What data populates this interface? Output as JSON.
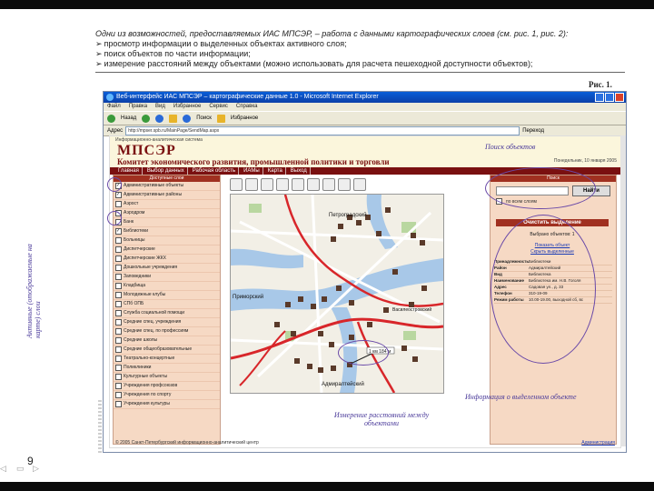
{
  "slide": {
    "intro": "Одни из возможностей, предоставляемых ИАС МПСЭР, – работа с данными картографических слоев (см. рис. 1, рис. 2):",
    "bullets": [
      "просмотр информации о выделенных объектах активного слоя;",
      "поиск объектов по части информации;",
      "измерение расстояний между объектами (можно использовать для расчета пешеходной доступности объектов);"
    ],
    "figure_label": "Рис. 1.",
    "page_number": "9"
  },
  "browser": {
    "title": "Веб-интерфейс ИАС МПСЭР – картографические данные 1.0 - Microsoft Internet Explorer",
    "menu": [
      "Файл",
      "Правка",
      "Вид",
      "Избранное",
      "Сервис",
      "Справка"
    ],
    "toolbar": {
      "back": "Назад",
      "search": "Поиск",
      "favorites": "Избранное"
    },
    "address_label": "Адрес",
    "address_value": "http://mpser.spb.ru/MainPage/SendMap.aspx",
    "go": "Переход"
  },
  "site": {
    "small_header": "Информационно-аналитическая система",
    "logo": "МПСЭР",
    "subtitle": "Комитет экономического развития, промышленной политики и торговли",
    "date": "Понедельник, 10 января 2005",
    "nav": [
      "Главная",
      "Выбор данных",
      "Рабочая область",
      "ИАМы",
      "Карта",
      "Выход"
    ],
    "layers_header": "Доступные слои",
    "layers": [
      {
        "label": "Административные объекты",
        "checked": true
      },
      {
        "label": "Административные районы",
        "checked": true
      },
      {
        "label": "Аэрост",
        "checked": false
      },
      {
        "label": "Аэродром",
        "checked": false
      },
      {
        "label": "Банк",
        "checked": false
      },
      {
        "label": "Библиотеки",
        "checked": true
      },
      {
        "label": "Больницы",
        "checked": false
      },
      {
        "label": "Диспетчерские",
        "checked": false
      },
      {
        "label": "Диспетчерские ЖКХ",
        "checked": false
      },
      {
        "label": "Дошкольные учреждения",
        "checked": false
      },
      {
        "label": "Заповедники",
        "checked": false
      },
      {
        "label": "Кладбища",
        "checked": false
      },
      {
        "label": "Молодежные клубы",
        "checked": false
      },
      {
        "label": "СПб ОПБ",
        "checked": false
      },
      {
        "label": "Служба социальной помощи",
        "checked": false
      },
      {
        "label": "Средние спец. учреждения",
        "checked": false
      },
      {
        "label": "Средние спец. по профессиям",
        "checked": false
      },
      {
        "label": "Средние школы",
        "checked": false
      },
      {
        "label": "Средние общеобразовательные",
        "checked": false
      },
      {
        "label": "Театрально-концертные",
        "checked": false
      },
      {
        "label": "Поликлиники",
        "checked": false
      },
      {
        "label": "Культурные объекты",
        "checked": false
      },
      {
        "label": "Учреждения профсоюзов",
        "checked": false
      },
      {
        "label": "Учреждения по спорту",
        "checked": false
      },
      {
        "label": "Учреждения культуры",
        "checked": false
      }
    ],
    "search_header": "Поиск",
    "find_button": "Найти",
    "search_option": "по всем слоям",
    "clear_selection": "Очистить выделение",
    "selected_count": "Выбрано объектов: 1",
    "object_links": [
      "Показать объект",
      "Скрыть выделенные"
    ],
    "object_info": [
      {
        "k": "Принадлежность",
        "v": "Библиотеки"
      },
      {
        "k": "Район",
        "v": "Адмиралтейский"
      },
      {
        "k": "Вид",
        "v": "Библиотека"
      },
      {
        "k": "Наименование",
        "v": "Библиотека им. Н.В. Гоголя"
      },
      {
        "k": "Адрес",
        "v": "Садовая ул., д. 33"
      },
      {
        "k": "Телефон",
        "v": "310-19-09"
      },
      {
        "k": "Режим работы",
        "v": "10.00-19.00, выходной сб, вс"
      }
    ],
    "map_places": [
      "Петроградский",
      "Адмиралтейский",
      "Приморский",
      "Василеостровский"
    ],
    "measure_label": "1 км 184 м",
    "footer_left": "© 2005 Санкт-Петербургский информационно-аналитический центр",
    "footer_right": "Администрация"
  },
  "annotations": {
    "search": "Поиск объектов",
    "active_layers": "Активные (отображаемые на карте) слои",
    "measure": "Измерение расстояний между объектами",
    "info": "Информация о выделенном объекте"
  },
  "colors": {
    "brand": "#7a1010",
    "panel": "#f6d9c4",
    "annotation": "#4a3a9a",
    "roads": "#d8262a"
  }
}
